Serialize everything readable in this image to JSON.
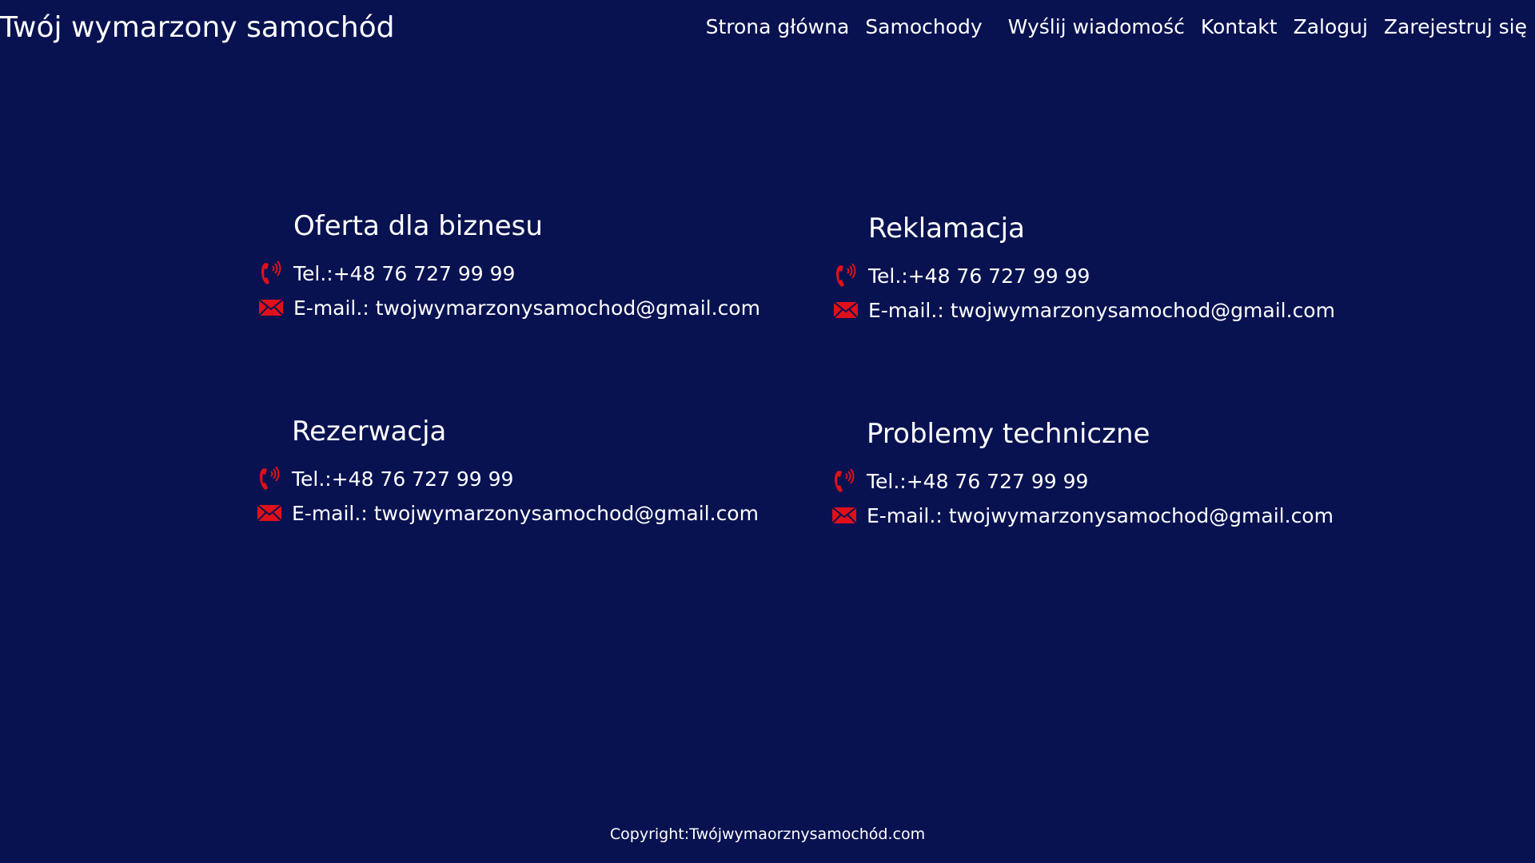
{
  "header": {
    "title": "Twój wymarzony samochód",
    "nav": [
      "Strona główna",
      "Samochody",
      "Wyślij wiadomość",
      "Kontakt",
      "Zaloguj",
      "Zarejestruj się"
    ]
  },
  "contacts": [
    {
      "title": "Oferta dla biznesu",
      "phone": "Tel.:+48 76 727 99 99",
      "email": "E-mail.: twojwymarzonysamochod@gmail.com"
    },
    {
      "title": "Reklamacja",
      "phone": "Tel.:+48 76 727 99 99",
      "email": "E-mail.: twojwymarzonysamochod@gmail.com"
    },
    {
      "title": "Rezerwacja",
      "phone": "Tel.:+48 76 727 99 99",
      "email": "E-mail.: twojwymarzonysamochod@gmail.com"
    },
    {
      "title": "Problemy techniczne",
      "phone": "Tel.:+48 76 727 99 99",
      "email": "E-mail.: twojwymarzonysamochod@gmail.com"
    }
  ],
  "footer": {
    "copyright": "Copyright:Twójwymaorznysamochód.com"
  },
  "colors": {
    "background": "#081251",
    "text": "#ffffff",
    "icon": "#e0101a"
  },
  "icons": {
    "phone": "phone-icon",
    "email": "envelope-icon"
  }
}
